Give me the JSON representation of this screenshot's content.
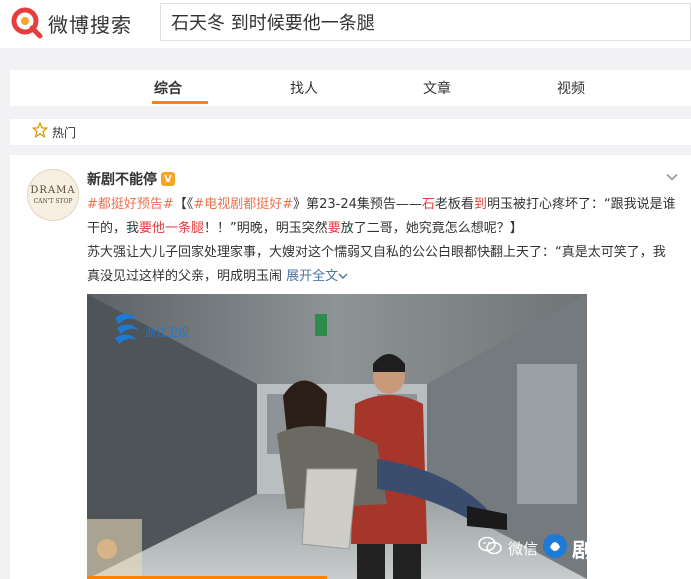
{
  "header": {
    "logo_text": "微博搜索",
    "search_value": "石天冬 到时候要他一条腿"
  },
  "tabs": [
    {
      "label": "综合",
      "active": true
    },
    {
      "label": "找人",
      "active": false
    },
    {
      "label": "文章",
      "active": false
    },
    {
      "label": "视频",
      "active": false
    }
  ],
  "hot": {
    "label": "热门"
  },
  "post": {
    "avatar_line1": "DRAMA",
    "avatar_line2": "CAN'T STOP",
    "author": "新剧不能停",
    "v_badge": "V",
    "tag1": "#都挺好预告#",
    "tag2": "#电视剧都挺好#",
    "p1a": "【《",
    "p1b": "》第23-24集预告——",
    "p1c": "石",
    "p1d": "老板看",
    "p1e": "到",
    "p1f": "明玉被打心疼坏了：“跟我说是谁干的，我",
    "p1g": "要他一条腿",
    "p1h": "！！”明晚，明玉突然",
    "p1i": "要",
    "p1j": "放了二哥，她究竟怎么想呢？】",
    "p2": "苏大强让大儿子回家处理家事，大嫂对这个懦弱又自私的公公白眼都快翻上天了：“真是太可笑了，我真没见过这样的父亲，明成明玉闹",
    "expand": "展开全文",
    "video_channel": "浙江卫视"
  },
  "watermark": {
    "prefix": "微信",
    "text": "剧情奥秘"
  },
  "colors": {
    "accent": "#ff8200",
    "highlight": "#e63e3e",
    "link": "#eb7350",
    "expand": "#4d73a8"
  }
}
